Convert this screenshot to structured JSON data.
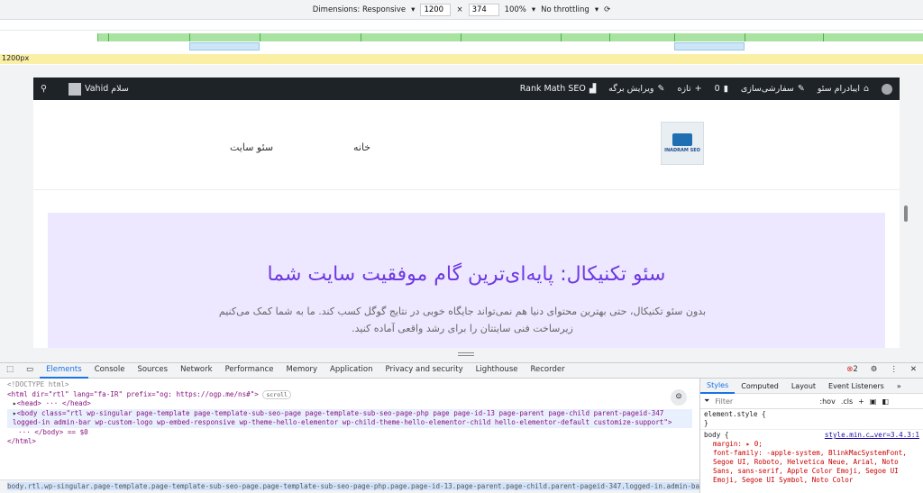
{
  "toolbar": {
    "dimensions_label": "Dimensions: Responsive",
    "width": "1200",
    "times": "×",
    "height": "374",
    "zoom": "100%",
    "throttle": "No throttling"
  },
  "ruler": {
    "label": "1200px"
  },
  "adminbar": {
    "site_name": "ایبادرام سئو",
    "customize": "سفارشی‌سازی",
    "comments_count": "0",
    "new_label": "تازه",
    "edit_page": "ویرایش برگه",
    "rank_math": "Rank Math SEO",
    "greeting": "سلام Vahid"
  },
  "site": {
    "logo_text": "INADRAM SEO",
    "nav_home": "خانه",
    "nav_seo": "سئو سایت",
    "hero_title": "سئو تکنیکال: پایه‌ای‌ترین گام موفقیت سایت شما",
    "hero_text": "بدون سئو تکنیکال، حتی بهترین محتوای دنیا هم نمی‌تواند جایگاه خوبی در نتایج گوگل کسب کند. ما به شما کمک می‌کنیم زیرساخت فنی سایتتان را برای رشد واقعی آماده کنید."
  },
  "devtools": {
    "tabs": [
      "Elements",
      "Console",
      "Sources",
      "Network",
      "Performance",
      "Memory",
      "Application",
      "Privacy and security",
      "Lighthouse",
      "Recorder"
    ],
    "error_count": "2",
    "elements": {
      "doctype": "<!DOCTYPE html>",
      "html_open": "<html dir=\"rtl\" lang=\"fa-IR\" prefix=\"og: https://ogp.me/ns#\">",
      "scroll_badge": "scroll",
      "head": "<head> ··· </head>",
      "body_open": "<body class=\"rtl wp-singular page-template page-template-sub-seo-page page-template-sub-seo-page-php page page-id-13 page-parent page-child parent-pageid-347 logged-in admin-bar wp-custom-logo wp-embed-responsive wp-theme-hello-elementor wp-child-theme-hello-elementor-child hello-elementor-default customize-support\">",
      "body_close": "··· </body> == $0",
      "html_close": "</html>"
    },
    "breadcrumb": "body.rtl.wp-singular.page-template.page-template-sub-seo-page.page-template-sub-seo-page-php.page.page-id-13.page-parent.page-child.parent-pageid-347.logged-in.admin-bar.wp-custom",
    "styles_tabs": [
      "Styles",
      "Computed",
      "Layout",
      "Event Listeners"
    ],
    "filter_placeholder": "Filter",
    "hov": ":hov",
    "cls": ".cls",
    "element_style": "element.style {",
    "close_brace": "}",
    "body_rule": "body {",
    "source": "style.min.c…ver=3.4.3:1",
    "margin": "margin: ▸ 0;",
    "font_family": "font-family: -apple-system, BlinkMacSystemFont, Segoe UI, Roboto, Helvetica Neue, Arial, Noto Sans, sans-serif, Apple Color Emoji, Segoe UI Emoji, Segoe UI Symbol, Noto Color"
  }
}
